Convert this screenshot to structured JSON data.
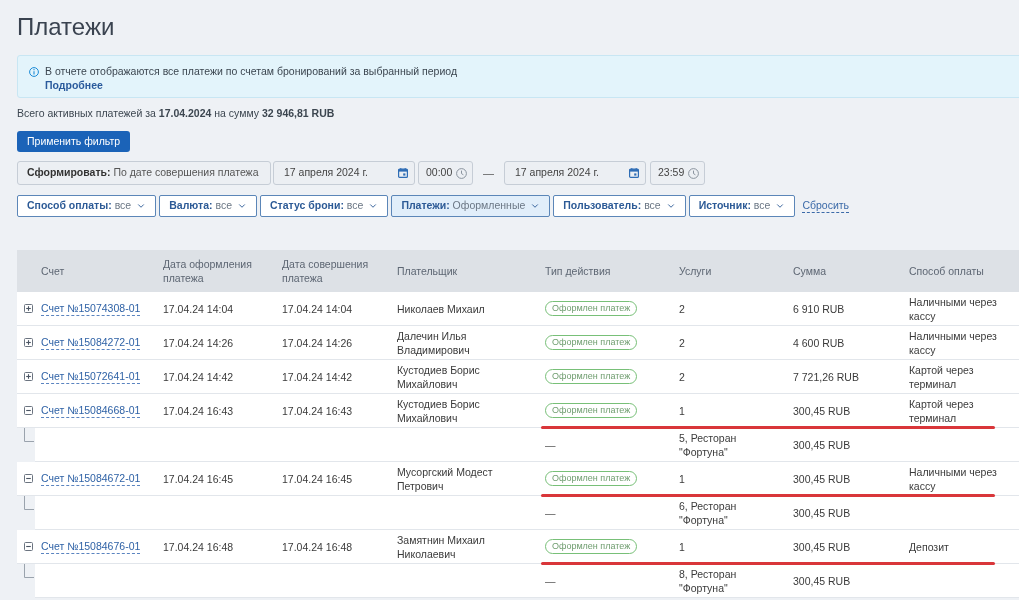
{
  "page": {
    "title": "Платежи"
  },
  "info": {
    "text": "В отчете отображаются все платежи по счетам бронирований за выбранный период",
    "link": "Подробнее"
  },
  "summary": {
    "text": "Всего активных платежей за **17.04.2024** на сумму **32 946,81 RUB**"
  },
  "apply_button": "Применить фильтр",
  "period": {
    "mode": {
      "label": "Сформировать:",
      "value": "По дате совершения платежа"
    },
    "from_date": "17 апреля 2024 г.",
    "from_time": "00:00",
    "separator": "—",
    "to_date": "17 апреля 2024 г.",
    "to_time": "23:59"
  },
  "filters": [
    {
      "label": "Способ оплаты:",
      "value": "все",
      "active": false
    },
    {
      "label": "Валюта:",
      "value": "все",
      "active": false
    },
    {
      "label": "Статус брони:",
      "value": "все",
      "active": false
    },
    {
      "label": "Платежи:",
      "value": "Оформленные",
      "active": true
    },
    {
      "label": "Пользователь:",
      "value": "все",
      "active": false
    },
    {
      "label": "Источник:",
      "value": "все",
      "active": false
    }
  ],
  "reset_link": "Сбросить",
  "table": {
    "columns": [
      "Счет",
      "Дата оформления платежа",
      "Дата совершения платежа",
      "Плательщик",
      "Тип действия",
      "Услуги",
      "Сумма",
      "Способ оплаты"
    ],
    "rows": [
      {
        "account": "Счет №15074308-01",
        "expanded": false,
        "annotated": false,
        "created": "17.04.24 14:04",
        "completed": "17.04.24 14:04",
        "payer": "Николаев Михаил",
        "action": {
          "kind": "badge",
          "text": "Оформлен платеж"
        },
        "services": "2",
        "amount": "6 910 RUB",
        "method": "Наличными через кассу"
      },
      {
        "account": "Счет №15084272-01",
        "expanded": false,
        "annotated": false,
        "created": "17.04.24 14:26",
        "completed": "17.04.24 14:26",
        "payer": "Далечин Илья Владимирович",
        "action": {
          "kind": "badge",
          "text": "Оформлен платеж"
        },
        "services": "2",
        "amount": "4 600 RUB",
        "method": "Наличными через кассу"
      },
      {
        "account": "Счет №15072641-01",
        "expanded": false,
        "annotated": false,
        "created": "17.04.24 14:42",
        "completed": "17.04.24 14:42",
        "payer": "Кустодиев Борис Михайлович",
        "action": {
          "kind": "badge",
          "text": "Оформлен платеж"
        },
        "services": "2",
        "amount": "7 721,26 RUB",
        "method": "Картой через терминал"
      },
      {
        "account": "Счет №15084668-01",
        "expanded": true,
        "annotated": true,
        "created": "17.04.24 16:43",
        "completed": "17.04.24 16:43",
        "payer": "Кустодиев Борис Михайлович",
        "action": {
          "kind": "badge",
          "text": "Оформлен платеж"
        },
        "services": "1",
        "amount": "300,45 RUB",
        "method": "Картой через терминал",
        "children": [
          {
            "action": {
              "kind": "text",
              "text": "—"
            },
            "services": "5, Ресторан \"Фортуна\"",
            "amount": "300,45 RUB"
          }
        ]
      },
      {
        "account": "Счет №15084672-01",
        "expanded": true,
        "annotated": true,
        "created": "17.04.24 16:45",
        "completed": "17.04.24 16:45",
        "payer": "Мусоргский Модест Петрович",
        "action": {
          "kind": "badge",
          "text": "Оформлен платеж"
        },
        "services": "1",
        "amount": "300,45 RUB",
        "method": "Наличными через кассу",
        "children": [
          {
            "action": {
              "kind": "text",
              "text": "—"
            },
            "services": "6, Ресторан \"Фортуна\"",
            "amount": "300,45 RUB"
          }
        ]
      },
      {
        "account": "Счет №15084676-01",
        "expanded": true,
        "annotated": true,
        "created": "17.04.24 16:48",
        "completed": "17.04.24 16:48",
        "payer": "Замятнин Михаил Николаевич",
        "action": {
          "kind": "badge",
          "text": "Оформлен платеж"
        },
        "services": "1",
        "amount": "300,45 RUB",
        "method": "Депозит",
        "children": [
          {
            "action": {
              "kind": "text",
              "text": "—"
            },
            "services": "8, Ресторан \"Фортуна\"",
            "amount": "300,45 RUB"
          }
        ]
      }
    ]
  }
}
